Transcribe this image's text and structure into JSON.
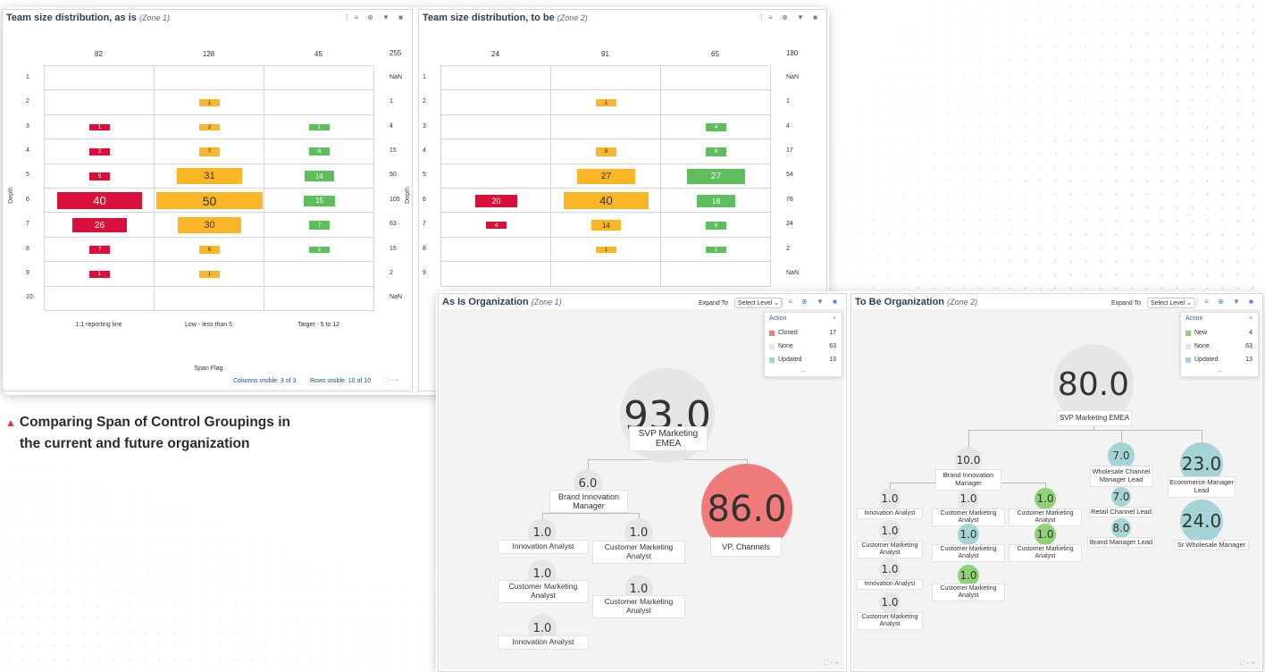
{
  "caption": {
    "line1": "Comparing Span of Control Groupings in",
    "line2": "the current and future organization"
  },
  "toolbar_icons": [
    "filter-list-icon",
    "globe-icon",
    "funnel-icon",
    "table-icon"
  ],
  "chart_data": [
    {
      "type": "bar",
      "title": "Team size distribution, as is",
      "zone": "(Zone 1)",
      "ylabel": "Depth",
      "xlabel": "Span Flag",
      "categories": [
        "1:1 reporting line",
        "Low - less than 5",
        "Target - 5 to 12"
      ],
      "column_totals": [
        "82",
        "128",
        "45"
      ],
      "grand_total": "255",
      "rows": [
        "1",
        "2",
        "3",
        "4",
        "5",
        "6",
        "7",
        "8",
        "9",
        "10"
      ],
      "row_totals": [
        "NaN",
        "1",
        "4",
        "15",
        "50",
        "105",
        "63",
        "15",
        "2",
        "NaN"
      ],
      "series": [
        {
          "name": "1:1 reporting line",
          "values": [
            null,
            null,
            1,
            2,
            5,
            40,
            26,
            7,
            1,
            null
          ]
        },
        {
          "name": "Low - less than 5",
          "values": [
            null,
            1,
            2,
            7,
            31,
            50,
            30,
            6,
            1,
            null
          ]
        },
        {
          "name": "Target - 5 to 12",
          "values": [
            null,
            null,
            1,
            6,
            14,
            15,
            7,
            2,
            null,
            null
          ]
        }
      ],
      "columns_visible": "Columns visible: 3 of 3",
      "rows_visible": "Rows visible: 10 of 10"
    },
    {
      "type": "bar",
      "title": "Team size distribution, to be",
      "zone": "(Zone 2)",
      "ylabel": "Depth",
      "column_totals": [
        "24",
        "91",
        "65"
      ],
      "grand_total": "180",
      "rows": [
        "1",
        "2",
        "3",
        "4",
        "5",
        "6",
        "7",
        "8",
        "9"
      ],
      "row_totals": [
        "NaN",
        "1",
        "4",
        "17",
        "54",
        "78",
        "24",
        "2",
        "NaN"
      ],
      "series": [
        {
          "values": [
            null,
            null,
            null,
            null,
            null,
            20,
            4,
            null,
            null
          ]
        },
        {
          "values": [
            null,
            1,
            null,
            8,
            27,
            40,
            14,
            1,
            null
          ]
        },
        {
          "values": [
            null,
            null,
            4,
            9,
            27,
            18,
            6,
            1,
            null
          ]
        }
      ]
    }
  ],
  "as_is_org": {
    "title": "As Is Organization",
    "zone": "(Zone 1)",
    "expand_to": "Expand To",
    "select": "Select Level",
    "legend": {
      "title": "Action",
      "close": "×",
      "more": "...",
      "items": [
        {
          "name": "Closed",
          "count": "17",
          "color": "#ef7b7b"
        },
        {
          "name": "None",
          "count": "63",
          "color": "#e5e5e5"
        },
        {
          "name": "Updated",
          "count": "13",
          "color": "#a4d4d6"
        }
      ]
    },
    "nodes": [
      {
        "value": "93.0",
        "label": "SVP Marketing EMEA"
      },
      {
        "value": "6.0",
        "label": "Brand Innovation Manager"
      },
      {
        "value": "86.0",
        "label": "VP, Channels"
      },
      {
        "value": "1.0",
        "label": "Innovation Analyst"
      },
      {
        "value": "1.0",
        "label": "Customer Marketing Analyst"
      },
      {
        "value": "1.0",
        "label": "Customer Marketing Analyst"
      },
      {
        "value": "1.0",
        "label": "Customer Marketing Analyst"
      },
      {
        "value": "1.0",
        "label": "Innovation Analyst"
      }
    ]
  },
  "to_be_org": {
    "title": "To Be Organization",
    "zone": "(Zone 2)",
    "expand_to": "Expand To",
    "select": "Select Level",
    "legend": {
      "title": "Action",
      "close": "×",
      "more": "...",
      "items": [
        {
          "name": "New",
          "count": "4",
          "color": "#8fd175"
        },
        {
          "name": "None",
          "count": "63",
          "color": "#e5e5e5"
        },
        {
          "name": "Updated",
          "count": "13",
          "color": "#a4d4d6"
        }
      ]
    },
    "nodes": [
      {
        "value": "80.0",
        "label": "SVP Marketing EMEA"
      },
      {
        "value": "10.0",
        "label": "Brand Innovation Manager"
      },
      {
        "value": "7.0",
        "label": "Wholesale Channel Manager Lead"
      },
      {
        "value": "23.0",
        "label": "Ecommerce Manager Lead"
      },
      {
        "value": "7.0",
        "label": "Retail Channel Lead"
      },
      {
        "value": "24.0",
        "label": "Sr Wholesale Manager"
      },
      {
        "value": "8.0",
        "label": "Brand Manager Lead"
      },
      {
        "value": "1.0",
        "label": "Innovation Analyst"
      },
      {
        "value": "1.0",
        "label": "Customer Marketing Analyst"
      },
      {
        "value": "1.0",
        "label": "Customer Marketing Analyst"
      },
      {
        "value": "1.0",
        "label": "Customer Marketing Analyst"
      },
      {
        "value": "1.0",
        "label": "Customer Marketing Analyst"
      },
      {
        "value": "1.0",
        "label": "Customer Marketing Analyst"
      },
      {
        "value": "1.0",
        "label": "Innovation Analyst"
      },
      {
        "value": "1.0",
        "label": "Customer Marketing Analyst"
      },
      {
        "value": "1.0",
        "label": "Customer Marketing Analyst"
      }
    ]
  }
}
